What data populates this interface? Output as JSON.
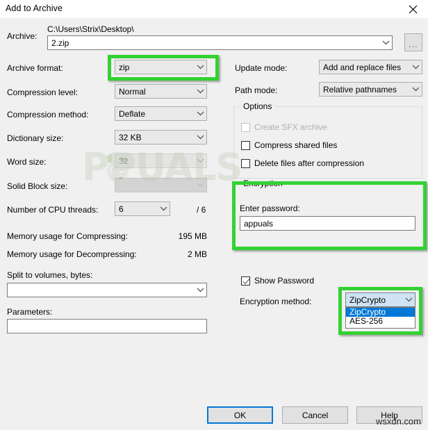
{
  "window": {
    "title": "Add to Archive",
    "close_icon": "close-icon"
  },
  "archive": {
    "label": "Archive:",
    "path": "C:\\Users\\Strix\\Desktop\\",
    "filename": "2.zip",
    "browse_label": "...",
    "dropdown_icon": "chevron-down-icon"
  },
  "left_column": {
    "archive_format": {
      "label": "Archive format:",
      "value": "zip",
      "disabled": false
    },
    "compression_level": {
      "label": "Compression level:",
      "value": "Normal",
      "disabled": false
    },
    "compression_method": {
      "label": "Compression method:",
      "value": "Deflate",
      "disabled": false
    },
    "dictionary_size": {
      "label": "Dictionary size:",
      "value": "32 KB",
      "disabled": false
    },
    "word_size": {
      "label": "Word size:",
      "value": "32",
      "disabled": true
    },
    "solid_block_size": {
      "label": "Solid Block size:",
      "value": "",
      "disabled": true
    },
    "cpu_threads": {
      "label": "Number of CPU threads:",
      "value": "6",
      "max": "/ 6",
      "disabled": false
    },
    "memory_compressing": {
      "label": "Memory usage for Compressing:",
      "value": "195 MB"
    },
    "memory_decompressing": {
      "label": "Memory usage for Decompressing:",
      "value": "2 MB"
    },
    "split_to_volumes": {
      "label": "Split to volumes, bytes:",
      "value": ""
    },
    "parameters": {
      "label": "Parameters:",
      "value": ""
    }
  },
  "right_column": {
    "update_mode": {
      "label": "Update mode:",
      "value": "Add and replace files"
    },
    "path_mode": {
      "label": "Path mode:",
      "value": "Relative pathnames"
    },
    "options": {
      "title": "Options",
      "items": [
        {
          "label": "Create SFX archive",
          "checked": false,
          "disabled": true
        },
        {
          "label": "Compress shared files",
          "checked": false,
          "disabled": false
        },
        {
          "label": "Delete files after compression",
          "checked": false,
          "disabled": false
        }
      ]
    },
    "encryption": {
      "title": "Encryption",
      "password_label": "Enter password:",
      "password_value": "appuals",
      "show_password": {
        "label": "Show Password",
        "checked": true
      },
      "method_label": "Encryption method:",
      "method_value": "ZipCrypto",
      "method_options": [
        "ZipCrypto",
        "AES-256"
      ],
      "method_selected_index": 0
    }
  },
  "footer": {
    "ok": "OK",
    "cancel": "Cancel",
    "help": "Help"
  },
  "watermarks": {
    "brand": "PPUALS",
    "site": "wsxdn.com"
  },
  "colors": {
    "highlight": "#33d133",
    "accent": "#0078d7",
    "dialog_bg": "#f0f0f0",
    "list_selection": "#0078d7"
  }
}
